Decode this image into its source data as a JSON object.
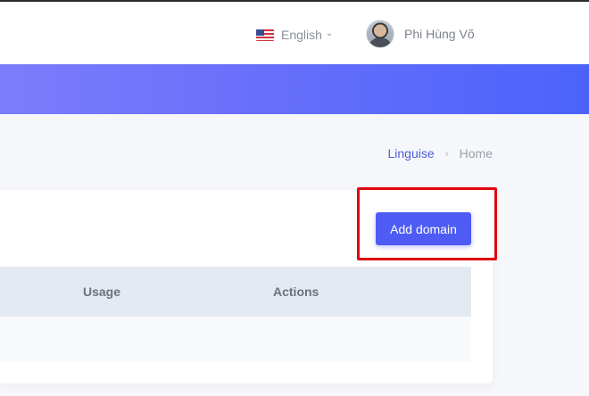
{
  "header": {
    "language": {
      "label": "English",
      "flag_icon": "us-flag-icon",
      "dropdown_icon": "chevron-down-icon"
    },
    "user": {
      "name": "Phi Hùng Võ"
    }
  },
  "breadcrumb": {
    "items": [
      "Linguise",
      "Home"
    ],
    "separator": "›"
  },
  "toolbar": {
    "add_domain_label": "Add domain"
  },
  "table": {
    "columns": [
      "Usage",
      "Actions"
    ]
  },
  "colors": {
    "accent": "#4e5cf5",
    "banner_start": "#7b7dfa",
    "banner_end": "#4b63fb",
    "highlight": "#e0070e",
    "link": "#4d5fd6"
  }
}
